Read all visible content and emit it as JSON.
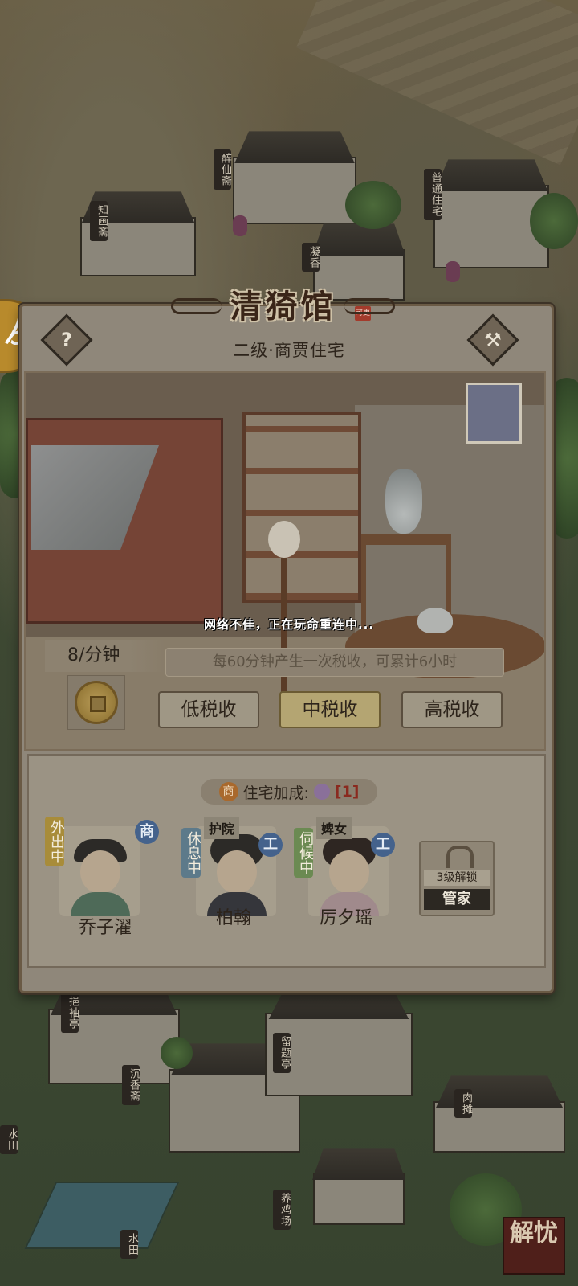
{
  "panel": {
    "title": "清猗馆",
    "title_stamp": "可更",
    "subtitle": "二级·商贾住宅",
    "help_icon": "question-icon",
    "hammer_icon": "hammer-icon"
  },
  "network_message": "网络不佳，正在玩命重连中...",
  "tax": {
    "rate": "8/分钟",
    "info": "每60分钟产生一次税收，可累计6小时",
    "buttons": [
      "低税收",
      "中税收",
      "高税收"
    ],
    "active": "中税收"
  },
  "bonus": {
    "shang": "商",
    "label": "住宅加成:",
    "value": "[1]"
  },
  "residents": [
    {
      "name": "乔子濯",
      "status": "外出中",
      "badge": "商",
      "role": ""
    },
    {
      "name": "柏翰",
      "status": "休息中",
      "badge": "工",
      "role": "护院"
    },
    {
      "name": "厉夕瑶",
      "status": "伺候中",
      "badge": "工",
      "role": "婢女"
    }
  ],
  "locked_slot": {
    "level": "3级解锁",
    "role": "管家"
  },
  "map_signs": [
    "醉仙斋",
    "知画斋",
    "普通住宅",
    "凝香",
    "留题亭",
    "沉香斋",
    "肉摊",
    "养鸡场",
    "水田",
    "水田",
    "挹袖亭"
  ],
  "corner_badge": "解忧",
  "colors": {
    "accent": "#b4a572",
    "panel": "#8f877a",
    "badge_blue": "#44628c"
  }
}
